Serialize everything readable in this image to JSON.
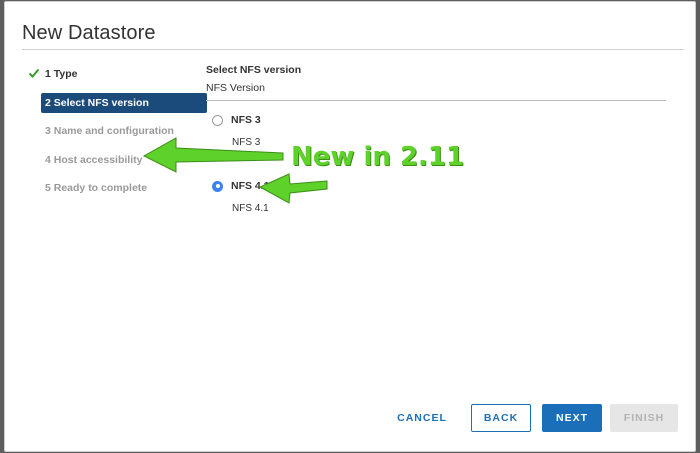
{
  "dialog": {
    "title": "New Datastore"
  },
  "steps": [
    {
      "label": "1 Type",
      "state": "done"
    },
    {
      "label": "2 Select NFS version",
      "state": "active"
    },
    {
      "label": "3 Name and configuration",
      "state": "todo"
    },
    {
      "label": "4 Host accessibility",
      "state": "todo"
    },
    {
      "label": "5 Ready to complete",
      "state": "todo"
    }
  ],
  "content": {
    "section_title": "Select NFS version",
    "field_label": "NFS Version",
    "options": [
      {
        "label": "NFS 3",
        "description": "NFS 3",
        "selected": false
      },
      {
        "label": "NFS 4.1",
        "description": "NFS 4.1",
        "selected": true
      }
    ]
  },
  "annotation": {
    "text": "New in 2.11",
    "color": "#5ed12a"
  },
  "buttons": {
    "cancel": "CANCEL",
    "back": "BACK",
    "next": "NEXT",
    "finish": "FINISH"
  },
  "colors": {
    "active_step": "#1b4b7a",
    "primary": "#1b6fb8",
    "link": "#1f6fb5",
    "check": "#3a9a2a"
  }
}
